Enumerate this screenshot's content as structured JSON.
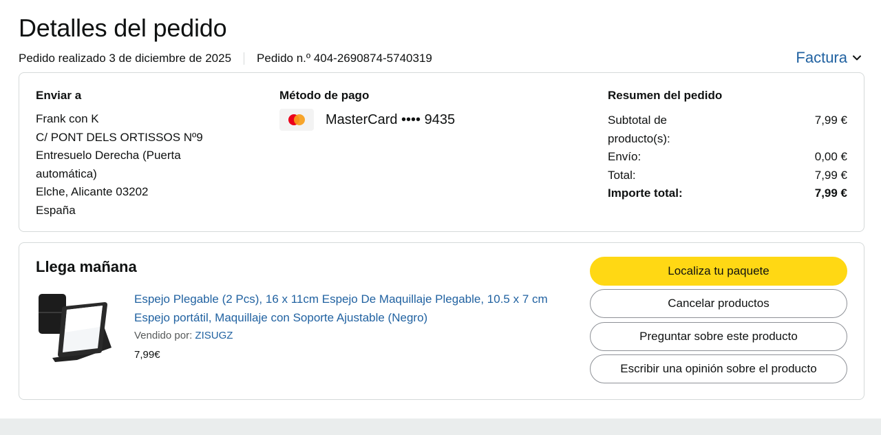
{
  "header": {
    "title": "Detalles del pedido",
    "order_date": "Pedido realizado 3 de diciembre de 2025",
    "order_number": "Pedido n.º 404-2690874-5740319",
    "invoice_label": "Factura"
  },
  "shipping": {
    "title": "Enviar a",
    "lines": [
      "Frank con K",
      "C/ PONT DELS ORTISSOS Nº9",
      "Entresuelo Derecha (Puerta",
      "automática)",
      "Elche, Alicante 03202",
      "España"
    ]
  },
  "payment": {
    "title": "Método de pago",
    "card_icon": "mastercard-logo",
    "card_text": "MasterCard •••• 9435"
  },
  "summary": {
    "title": "Resumen del pedido",
    "rows": [
      {
        "label": "Subtotal de producto(s):",
        "value": "7,99 €"
      },
      {
        "label": "Envío:",
        "value": "0,00 €"
      },
      {
        "label": "Total:",
        "value": "7,99 €"
      },
      {
        "label": "Importe total:",
        "value": "7,99 €"
      }
    ]
  },
  "shipment": {
    "status": "Llega mañana",
    "product_image": "folding-mirror-product-image",
    "product_title": "Espejo Plegable (2 Pcs), 16 x 11cm Espejo De Maquillaje Plegable, 10.5 x 7 cm Espejo portátil, Maquillaje con Soporte Ajustable (Negro)",
    "seller_prefix": "Vendido por:",
    "seller_name": "ZISUGZ",
    "price": "7,99€"
  },
  "actions": {
    "track": "Localiza tu paquete",
    "cancel": "Cancelar productos",
    "ask": "Preguntar sobre este producto",
    "review": "Escribir una opinión sobre el producto"
  },
  "colors": {
    "link": "#2162a1",
    "primary_button": "#ffd814",
    "border": "#d5d9d9"
  }
}
